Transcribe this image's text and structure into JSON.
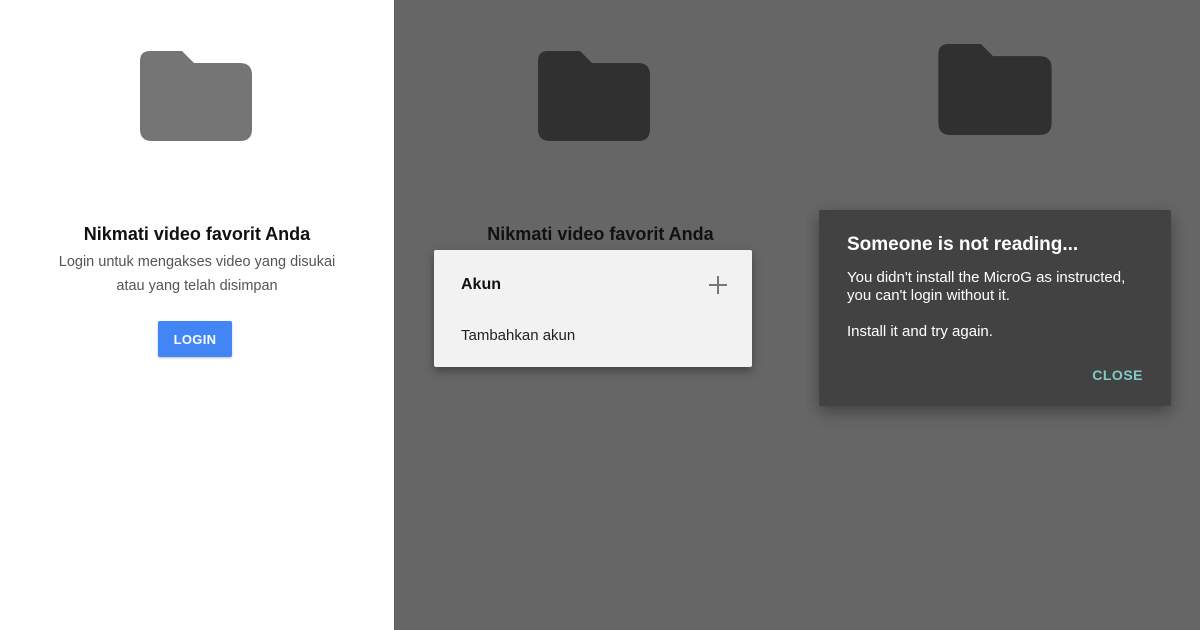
{
  "colors": {
    "login_button": "#4285f4",
    "folder_light": "#757575",
    "folder_dark": "#303030",
    "scrim": "#666666",
    "dialog_bg": "#424242",
    "dialog_action": "#80cbc4"
  },
  "panel_login": {
    "icon": "folder-icon",
    "title": "Nikmati video favorit Anda",
    "subtitle_line1": "Login untuk mengakses video yang disukai",
    "subtitle_line2": "atau yang telah disimpan",
    "login_label": "LOGIN"
  },
  "panel_accounts": {
    "icon": "folder-icon",
    "title": "Nikmati video favorit Anda",
    "menu": {
      "title": "Akun",
      "add_icon": "plus-icon",
      "items": [
        {
          "label": "Tambahkan akun"
        }
      ]
    }
  },
  "panel_error": {
    "icon": "folder-icon",
    "dialog": {
      "title": "Someone is not reading...",
      "message_line1": "You didn't install the MicroG as instructed, you can't login without it.",
      "message_line2": "Install it and try again.",
      "close_label": "CLOSE"
    }
  }
}
